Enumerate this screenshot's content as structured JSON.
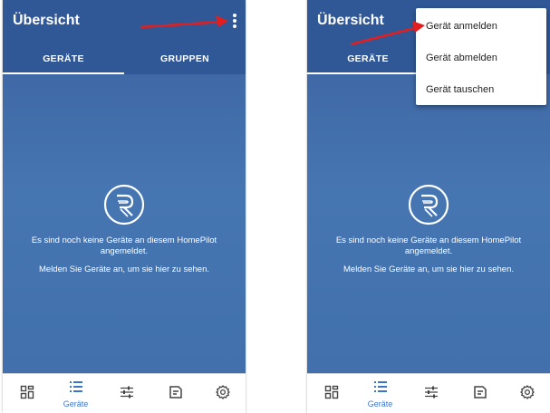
{
  "screens": [
    {
      "header": {
        "title": "Übersicht"
      },
      "tabs": [
        {
          "label": "GERÄTE"
        },
        {
          "label": "GRUPPEN"
        }
      ],
      "empty_state": {
        "line1": "Es sind noch keine Geräte an diesem HomePilot angemeldet.",
        "line2": "Melden Sie Geräte an, um sie hier zu sehen."
      },
      "bottom_nav": {
        "active_label": "Geräte"
      }
    },
    {
      "header": {
        "title": "Übersicht"
      },
      "tabs": [
        {
          "label": "GERÄTE"
        }
      ],
      "empty_state": {
        "line1": "Es sind noch keine Geräte an diesem HomePilot angemeldet.",
        "line2": "Melden Sie Geräte an, um sie hier zu sehen."
      },
      "bottom_nav": {
        "active_label": "Geräte"
      },
      "menu": {
        "items": [
          {
            "label": "Gerät anmelden"
          },
          {
            "label": "Gerät abmelden"
          },
          {
            "label": "Gerät tauschen"
          }
        ]
      }
    }
  ],
  "colors": {
    "appbar": "#305896",
    "content": "#3f69a6",
    "accent": "#3c76c9",
    "annotation_arrow": "#e41e1e"
  },
  "icons": [
    "more-vert-icon",
    "app-logo-icon",
    "dashboard-icon",
    "list-icon",
    "sliders-icon",
    "notes-icon",
    "gear-icon"
  ]
}
